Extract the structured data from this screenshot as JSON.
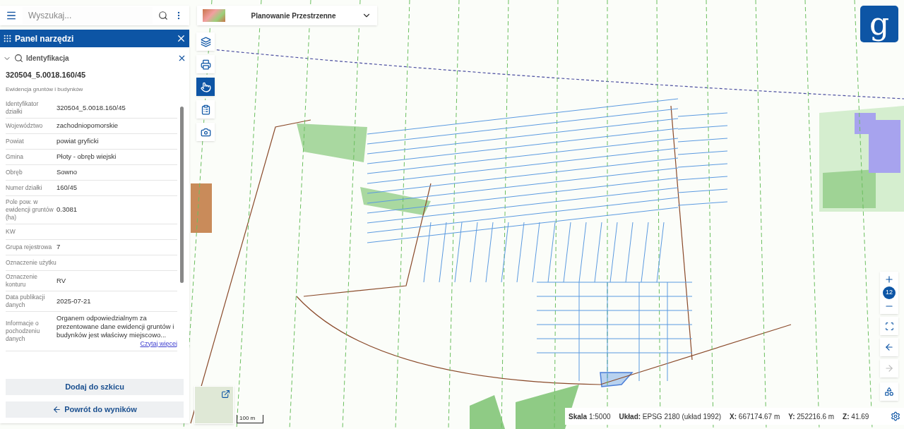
{
  "search": {
    "placeholder": "Wyszukaj..."
  },
  "layer_selector": {
    "title": "Planowanie Przestrzenne"
  },
  "logo": {
    "letter": "g"
  },
  "tool_panel": {
    "title": "Panel narzędzi",
    "section": {
      "title": "Identyfikacja",
      "expanded": true,
      "object_id": "320504_5.0018.160/45",
      "source": "Ewidencja gruntów i budynków"
    },
    "attributes": [
      {
        "label": "Identyfikator działki",
        "value": "320504_5.0018.160/45"
      },
      {
        "label": "Województwo",
        "value": "zachodniopomorskie"
      },
      {
        "label": "Powiat",
        "value": "powiat gryficki"
      },
      {
        "label": "Gmina",
        "value": "Płoty - obręb wiejski"
      },
      {
        "label": "Obręb",
        "value": "Sowno"
      },
      {
        "label": "Numer działki",
        "value": "160/45"
      },
      {
        "label": "Pole pow. w ewidencji gruntów (ha)",
        "value": "0.3081"
      },
      {
        "label": "KW"
      },
      {
        "label": "Grupa rejestrowa",
        "value": "7"
      },
      {
        "label": "Oznaczenie użytku"
      },
      {
        "label": "Oznaczenie konturu",
        "value": "RV"
      },
      {
        "label": "Data publikacji danych",
        "value": "2025-07-21"
      },
      {
        "label": "Informacje o pochodzeniu danych",
        "value": "Organem odpowiedzialnym za prezentowane dane ewidencji gruntów i budynków jest właściwy miejscowo...",
        "link": "Czytaj więcej"
      }
    ],
    "buttons": [
      {
        "kind": "add",
        "label": "Dodaj do szkicu"
      },
      {
        "kind": "back",
        "label": "Powrót do wyników"
      }
    ]
  },
  "map_toolbar": [
    {
      "kind": "layers",
      "selected": false
    },
    {
      "kind": "print",
      "selected": false
    },
    {
      "kind": "identify",
      "selected": true
    },
    {
      "kind": "clipboard",
      "selected": false
    },
    {
      "kind": "camera",
      "selected": false
    }
  ],
  "zoom": {
    "level_label": "12"
  },
  "history": {
    "back_disabled": false,
    "forward_disabled": true
  },
  "scale_bar": {
    "label": "100 m"
  },
  "status_bar": [
    {
      "label": "Skala",
      "value": "1:5000"
    },
    {
      "label": "Układ:",
      "value": "EPSG 2180 (układ 1992)"
    },
    {
      "label": "X:",
      "value": "667174.67 m"
    },
    {
      "label": "Y:",
      "value": "252216.6 m"
    },
    {
      "label": "Z:",
      "value": "41.69"
    }
  ]
}
